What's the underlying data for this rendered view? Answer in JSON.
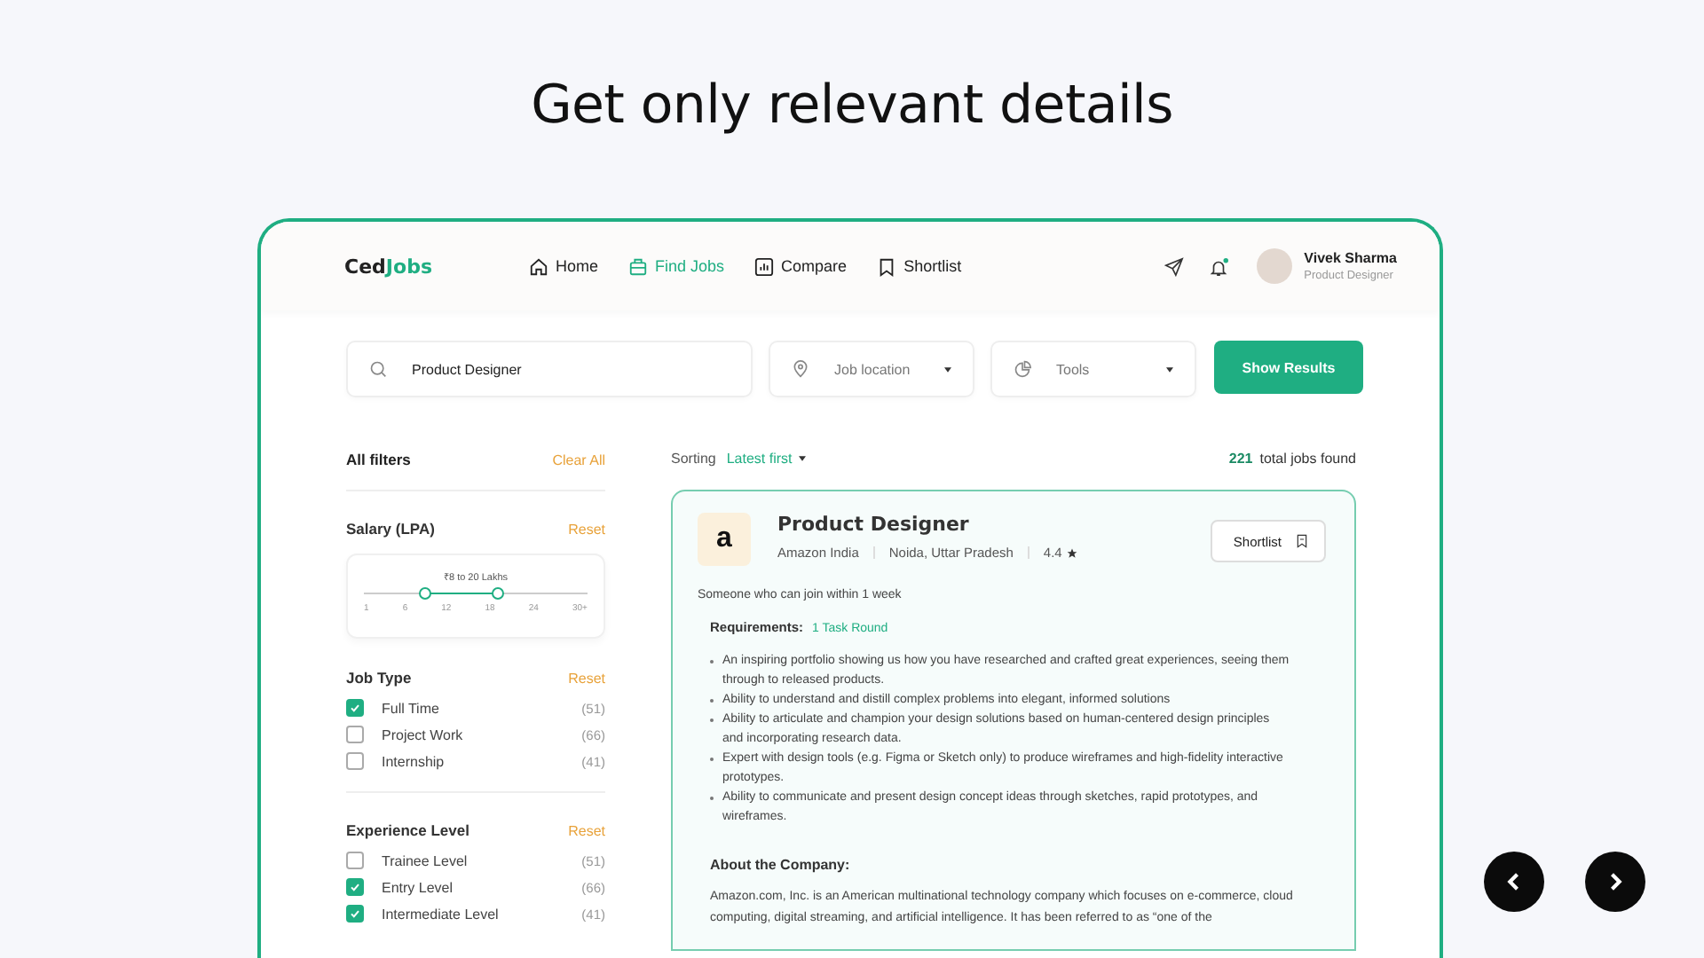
{
  "headline": "Get only relevant details",
  "app": {
    "logo": {
      "part1": "Ced",
      "part2": "Jobs"
    },
    "nav": [
      {
        "label": "Home",
        "selected": false
      },
      {
        "label": "Find Jobs",
        "selected": true
      },
      {
        "label": "Compare",
        "selected": false
      },
      {
        "label": "Shortlist",
        "selected": false
      }
    ],
    "notifications_unread": true,
    "user": {
      "name": "Vivek Sharma",
      "role": "Product Designer"
    },
    "search": {
      "value": "Product Designer",
      "location_placeholder": "Job location",
      "tools_placeholder": "Tools",
      "button": "Show Results"
    },
    "filters": {
      "title": "All filters",
      "clear": "Clear All",
      "salary": {
        "title": "Salary (LPA)",
        "reset": "Reset",
        "range_label": "₹8 to 20 Lakhs",
        "handles": [
          {
            "level": 0.27
          },
          {
            "level": 0.6
          }
        ],
        "ticks": [
          "1",
          "6",
          "12",
          "18",
          "24",
          "30+"
        ]
      },
      "groups": [
        {
          "title": "Job Type",
          "reset": "Reset",
          "options": [
            {
              "label": "Full Time",
              "count": "(51)",
              "checked": true
            },
            {
              "label": "Project Work",
              "count": "(66)",
              "checked": false
            },
            {
              "label": "Internship",
              "count": "(41)",
              "checked": false
            }
          ]
        },
        {
          "title": "Experience Level",
          "reset": "Reset",
          "options": [
            {
              "label": "Trainee Level",
              "count": "(51)",
              "checked": false
            },
            {
              "label": "Entry Level",
              "count": "(66)",
              "checked": true
            },
            {
              "label": "Intermediate Level",
              "count": "(41)",
              "checked": true
            }
          ]
        }
      ]
    },
    "results": {
      "sorting_label": "Sorting",
      "sorting_value": "Latest first",
      "count": "221",
      "count_label": "total jobs found"
    },
    "job": {
      "title": "Product Designer",
      "company_logo": "a",
      "company": "Amazon India",
      "location": "Noida, Uttar Pradesh",
      "rating": "4.4",
      "shortlist": "Shortlist",
      "summary": "Someone who can join within 1 week",
      "requirements_label": "Requirements:",
      "requirements_tag": "1 Task Round",
      "bullets": [
        "An inspiring portfolio showing us how you have researched and crafted great experiences, seeing them through to released products.",
        "Ability to understand and distill complex problems into elegant, informed solutions",
        "Ability to articulate and champion your design solutions based on human-centered design principles and incorporating research data.",
        "Expert with design tools (e.g. Figma or Sketch only) to produce wireframes and high-fidelity interactive prototypes.",
        "Ability to communicate and present design concept ideas through sketches, rapid prototypes, and wireframes."
      ],
      "about_title": "About the Company:",
      "about_text": "Amazon.com, Inc. is an American multinational technology company which focuses on e-commerce, cloud computing, digital streaming, and artificial intelligence. It has been referred to as “one of the"
    }
  }
}
